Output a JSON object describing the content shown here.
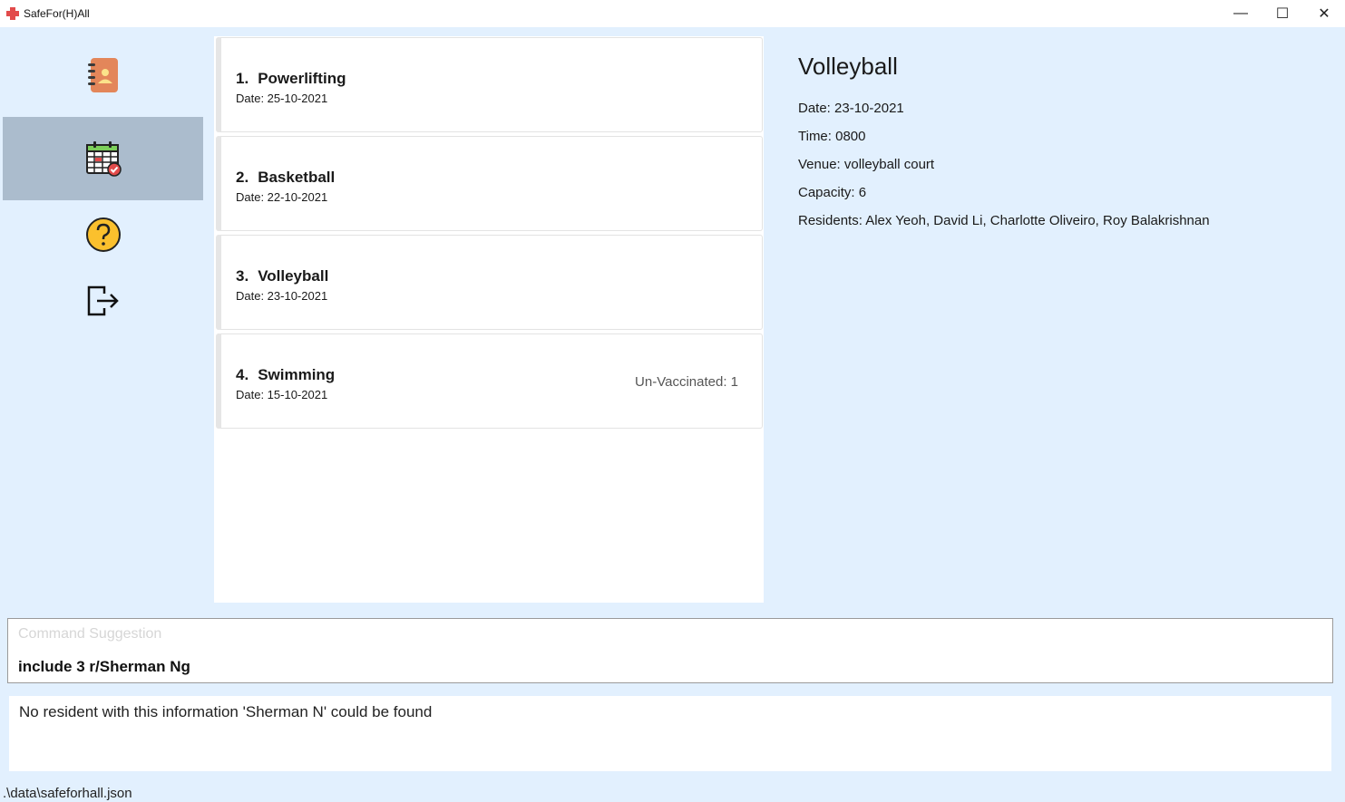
{
  "window": {
    "title": "SafeFor(H)All",
    "minimize_glyph": "—",
    "maximize_glyph": "☐",
    "close_glyph": "✕"
  },
  "sidebar": {
    "items": [
      {
        "icon": "address-book-icon",
        "active": false
      },
      {
        "icon": "calendar-icon",
        "active": true
      },
      {
        "icon": "help-icon",
        "active": false
      },
      {
        "icon": "exit-icon",
        "active": false
      }
    ]
  },
  "events": [
    {
      "index": "1.",
      "name": "Powerlifting",
      "date": "Date: 25-10-2021",
      "flag": ""
    },
    {
      "index": "2.",
      "name": "Basketball",
      "date": "Date: 22-10-2021",
      "flag": ""
    },
    {
      "index": "3.",
      "name": "Volleyball",
      "date": "Date: 23-10-2021",
      "flag": ""
    },
    {
      "index": "4.",
      "name": "Swimming",
      "date": "Date: 15-10-2021",
      "flag": "Un-Vaccinated: 1"
    }
  ],
  "detail": {
    "title": "Volleyball",
    "date": "Date: 23-10-2021",
    "time": "Time: 0800",
    "venue": "Venue: volleyball court",
    "capacity": "Capacity: 6",
    "residents": "Residents: Alex Yeoh, David Li, Charlotte Oliveiro, Roy Balakrishnan"
  },
  "command": {
    "suggestion": "Command Suggestion",
    "input": "include 3 r/Sherman Ng"
  },
  "result": {
    "message": "No resident with this information 'Sherman N' could be found"
  },
  "status": {
    "path": ".\\data\\safeforhall.json"
  },
  "colors": {
    "background": "#e2f0fe",
    "active_nav": "#abbccd",
    "accent_red": "#e24b4b"
  }
}
